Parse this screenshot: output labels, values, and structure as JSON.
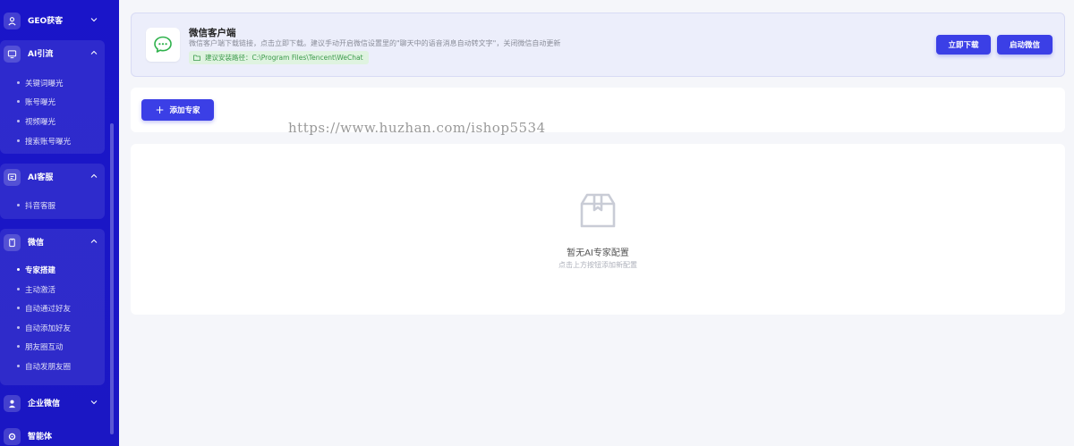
{
  "sidebar": {
    "groups": [
      {
        "title": "GEO获客",
        "icon": "user-pin-icon"
      },
      {
        "title": "AI引流",
        "icon": "funnel-icon",
        "items": [
          "关键词曝光",
          "账号曝光",
          "视频曝光",
          "搜索账号曝光"
        ]
      },
      {
        "title": "AI客服",
        "icon": "chat-icon",
        "items": [
          "抖音客服"
        ]
      },
      {
        "title": "微信",
        "icon": "phone-icon",
        "items": [
          "专家搭建",
          "主动激活",
          "自动通过好友",
          "自动添加好友",
          "朋友圈互动",
          "自动发朋友圈"
        ],
        "active_item": "专家搭建"
      },
      {
        "title": "企业微信",
        "icon": "person-icon"
      },
      {
        "title": "智能体",
        "icon": "gear-icon"
      }
    ]
  },
  "banner": {
    "title": "微信客户端",
    "description": "微信客户端下载链接，点击立即下载。建议手动开启微信设置里的\"聊天中的语音消息自动转文字\"，关闭微信自动更新",
    "path_label": "建议安装路径：C:\\Program Files\\Tencent\\WeChat",
    "download_button": "立即下载",
    "launch_button": "启动微信"
  },
  "toolbar": {
    "add_button": "添加专家"
  },
  "watermark": "https://www.huzhan.com/ishop5534",
  "empty_state": {
    "title": "暂无AI专家配置",
    "subtitle": "点击上方按钮添加新配置"
  },
  "colors": {
    "sidebar": "#1a15c9",
    "primary": "#3b3fe6",
    "wechat_green": "#2fb24c"
  }
}
